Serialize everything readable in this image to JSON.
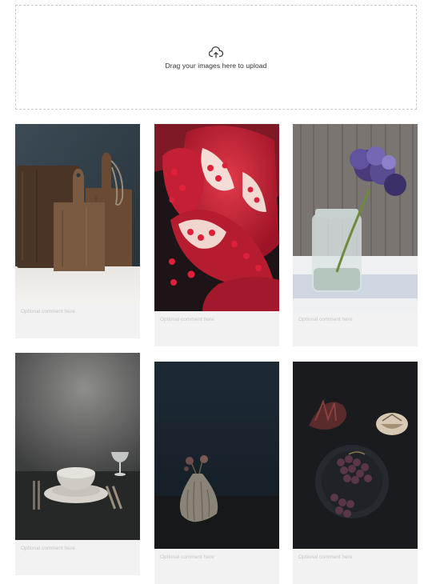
{
  "upload": {
    "prompt": "Drag your images here to upload",
    "icon": "cloud-upload-icon"
  },
  "gallery": {
    "items": [
      {
        "name": "cutting-boards",
        "comment_placeholder": "Optional comment here"
      },
      {
        "name": "pomegranate",
        "comment_placeholder": "Optional comment here"
      },
      {
        "name": "hydrangea-jar",
        "comment_placeholder": "Optional comment here"
      },
      {
        "name": "table-setting",
        "comment_placeholder": "Optional comment here"
      },
      {
        "name": "vase",
        "comment_placeholder": "Optional comment here"
      },
      {
        "name": "grapes-plate",
        "comment_placeholder": "Optional comment here"
      }
    ]
  }
}
